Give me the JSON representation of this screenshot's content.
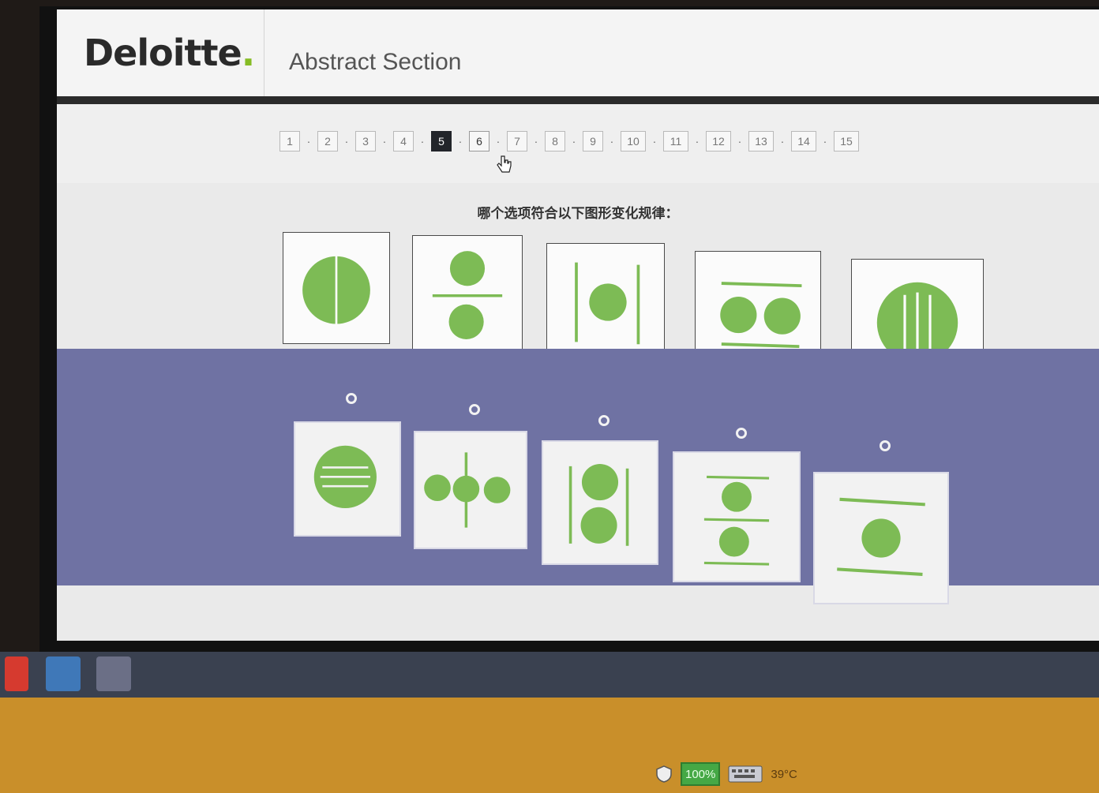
{
  "header": {
    "logo_text": "Deloitte",
    "logo_dot": ".",
    "section_title": "Abstract Section"
  },
  "pager": {
    "pages": [
      "1",
      "2",
      "3",
      "4",
      "5",
      "6",
      "7",
      "8",
      "9",
      "10",
      "11",
      "12",
      "13",
      "14",
      "15"
    ],
    "separator": "·",
    "active_page": "5"
  },
  "question": {
    "text": "哪个选项符合以下图形变化规律："
  },
  "sequence": {
    "items": [
      {
        "icon": "circle-split-vertical-icon"
      },
      {
        "icon": "two-circles-stacked-divider-icon"
      },
      {
        "icon": "circle-between-vertical-lines-icon"
      },
      {
        "icon": "two-circles-between-horizontal-lines-icon"
      },
      {
        "icon": "circle-with-three-vertical-lines-icon"
      }
    ]
  },
  "options": {
    "items": [
      {
        "icon": "circle-with-three-horizontal-lines-icon"
      },
      {
        "icon": "three-circles-on-vertical-line-icon"
      },
      {
        "icon": "two-stacked-circles-between-vertical-lines-icon"
      },
      {
        "icon": "two-circles-with-three-horizontal-lines-icon"
      },
      {
        "icon": "circle-between-horizontal-lines-icon"
      }
    ]
  },
  "taskbar": {
    "battery_label": "100%",
    "temperature": "39°C"
  },
  "colors": {
    "accent_green": "#86bc25",
    "shape_green": "#7dbb55",
    "options_band": "#6f72a3",
    "active_page": "#22252a"
  }
}
